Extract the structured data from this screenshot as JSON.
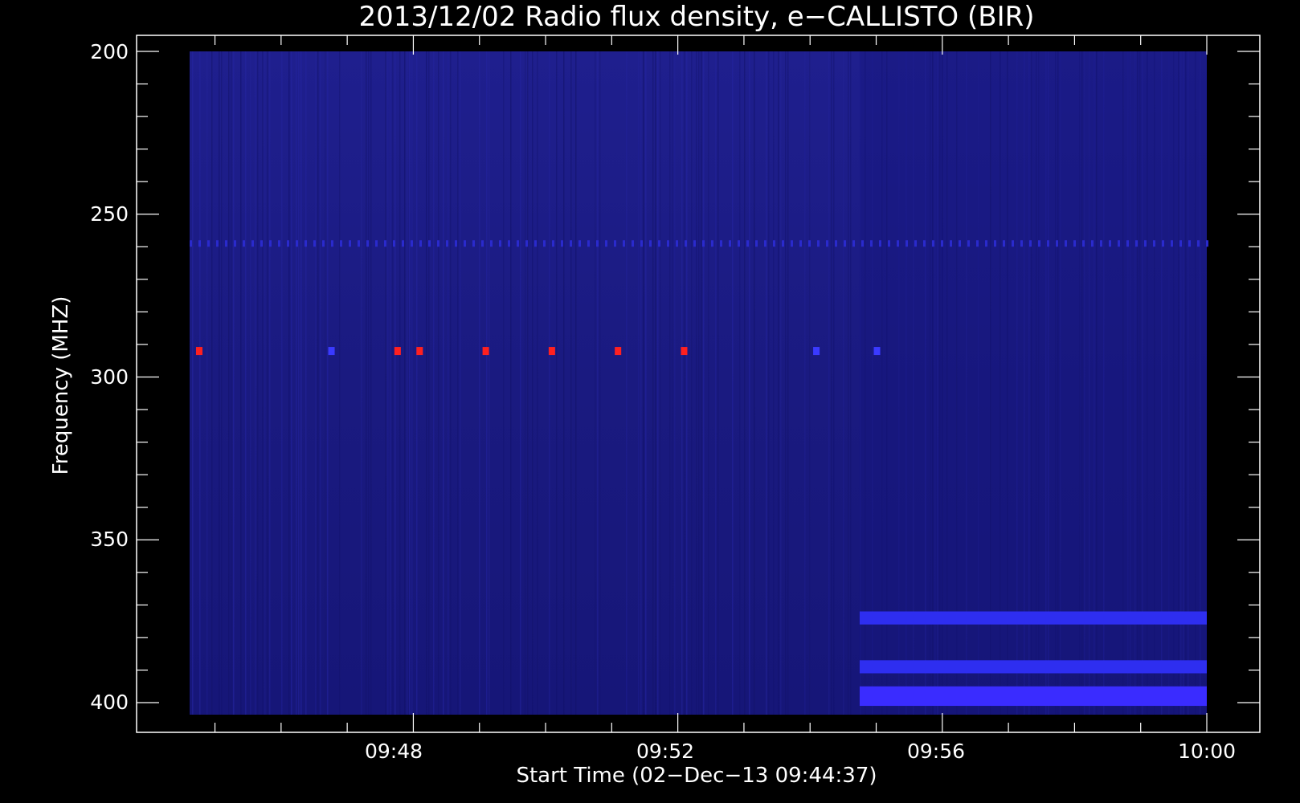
{
  "chart_data": {
    "type": "heatmap",
    "title": "2013/12/02  Radio flux density, e−CALLISTO (BIR)",
    "xlabel": "Start Time (02−Dec−13 09:44:37)",
    "ylabel": "Frequency (MHZ)",
    "x_range": [
      "09:44:37",
      "10:00:00"
    ],
    "y_range_mhz": [
      200,
      405
    ],
    "y_axis_inverted": true,
    "x_ticks": [
      "09:48",
      "09:52",
      "09:56",
      "10:00"
    ],
    "y_ticks": [
      200,
      250,
      300,
      350,
      400
    ],
    "background_color": "#1b1b86",
    "grid": false,
    "features": [
      {
        "kind": "interference-dots",
        "frequency_mhz": 292,
        "times": [
          "09:44:45",
          "09:46:45",
          "09:47:45",
          "09:48:05",
          "09:49:05",
          "09:50:05",
          "09:51:05",
          "09:52:05",
          "09:54:05",
          "09:55:00"
        ],
        "colors": [
          "#ff2020",
          "#3a3aff",
          "#ff2020",
          "#ff2020",
          "#ff2020",
          "#ff2020",
          "#ff2020",
          "#ff2020",
          "#3a3aff",
          "#3a3aff"
        ]
      },
      {
        "kind": "interference-line",
        "frequency_mhz": 259,
        "time_range": [
          "09:44:37",
          "10:00:00"
        ],
        "color": "#2a2acc"
      },
      {
        "kind": "band",
        "frequency_range_mhz": [
          372,
          376
        ],
        "time_range": [
          "09:54:45",
          "10:00:00"
        ],
        "color": "#2e2ef0"
      },
      {
        "kind": "band",
        "frequency_range_mhz": [
          387,
          391
        ],
        "time_range": [
          "09:54:45",
          "10:00:00"
        ],
        "color": "#2e2ef0"
      },
      {
        "kind": "band",
        "frequency_range_mhz": [
          395,
          401
        ],
        "time_range": [
          "09:54:45",
          "10:00:00"
        ],
        "color": "#3a2cff"
      }
    ]
  }
}
